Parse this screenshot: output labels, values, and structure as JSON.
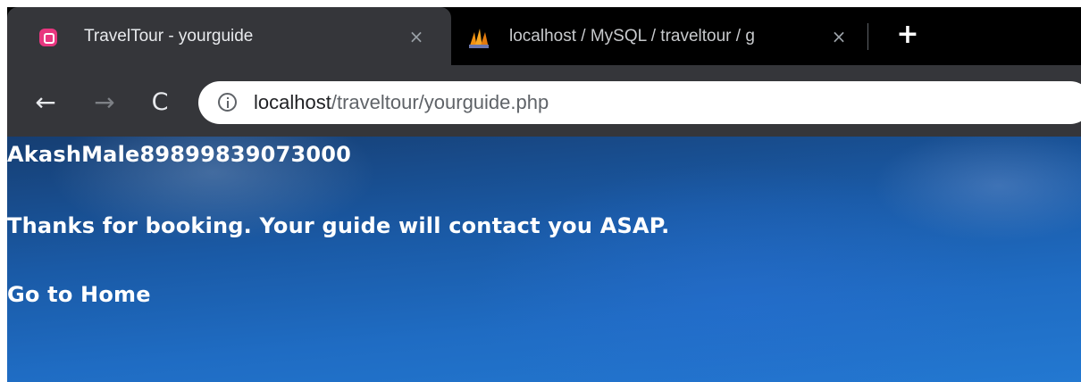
{
  "browser": {
    "tabs": [
      {
        "title": "TravelTour - yourguide",
        "active": true,
        "favicon": "wamp-icon"
      },
      {
        "title": "localhost / MySQL / traveltour / g",
        "active": false,
        "favicon": "phpmyadmin-icon"
      }
    ],
    "close_symbol": "×",
    "new_tab_symbol": "+",
    "nav": {
      "back": "←",
      "forward": "→",
      "reload": "C"
    },
    "address": {
      "host": "localhost",
      "path": "/traveltour/yourguide.php"
    },
    "colors": {
      "tabstrip": "#000000",
      "toolbar": "#35363a",
      "accent_favicon": "#e8367f"
    }
  },
  "page": {
    "record": "AkashMale89899839073000",
    "message": "Thanks for booking. Your guide will contact you ASAP.",
    "home_link": "Go to Home",
    "colors": {
      "text": "#ffffff",
      "background": "#1a5aa6"
    }
  }
}
